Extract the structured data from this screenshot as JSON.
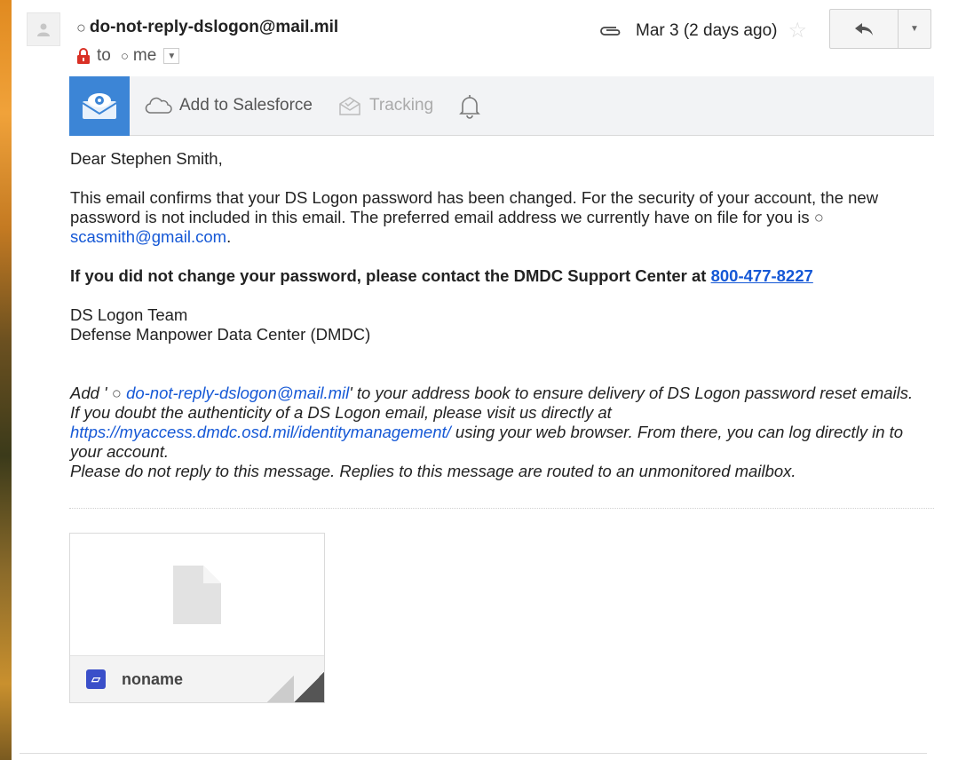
{
  "email": {
    "sender": "do-not-reply-dslogon@mail.mil",
    "to_label": "to",
    "recipient": "me",
    "date": "Mar 3 (2 days ago)"
  },
  "toolbar": {
    "salesforce_label": "Add to Salesforce",
    "tracking_label": "Tracking"
  },
  "body": {
    "greeting": "Dear Stephen Smith,",
    "para1_text": "This email confirms that your DS Logon password has been changed. For the security of your account, the new password is not included in this email. The preferred email address we currently have on file for you is ",
    "para1_email": "scasmith@gmail.com",
    "para1_end": ".",
    "warning_text": "If you did not change your password, please contact the DMDC Support Center at ",
    "phone": "800-477-8227",
    "team": "DS Logon Team",
    "org": "Defense Manpower Data Center (DMDC)",
    "footer_add_start": "Add '",
    "footer_sender": "do-not-reply-dslogon@mail.mil",
    "footer_add_end": "' to your address book to ensure delivery of DS Logon password reset emails. If you doubt the authenticity of a DS Logon email, please visit us directly at ",
    "footer_url": "https://myaccess.dmdc.osd.mil/identitymanagement/",
    "footer_after_url": " using your web browser. From there, you can log directly in to your account.",
    "footer_noreply": "Please do not reply to this message. Replies to this message are routed to an unmonitored mailbox."
  },
  "attachment": {
    "name": "noname"
  },
  "colors": {
    "link": "#1558d6",
    "toolbar_logo": "#3c85d6",
    "lock": "#d93025"
  }
}
